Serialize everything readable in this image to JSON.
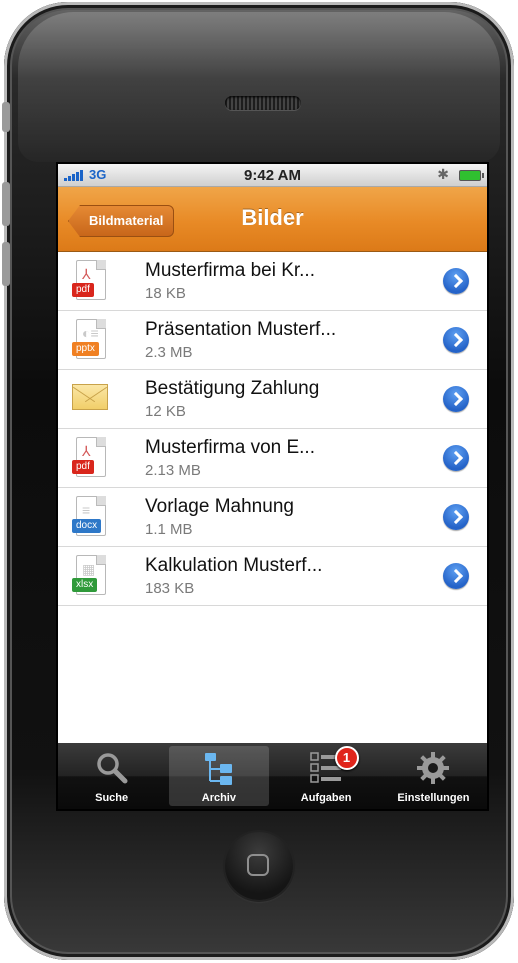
{
  "status_bar": {
    "network": "3G",
    "time": "9:42 AM"
  },
  "nav": {
    "back_label": "Bildmaterial",
    "title": "Bilder"
  },
  "files": [
    {
      "name": "Musterfirma bei Kr...",
      "size": "18 KB",
      "type": "pdf",
      "color": "#d9261c"
    },
    {
      "name": "Präsentation Musterf...",
      "size": "2.3 MB",
      "type": "pptx",
      "color": "#f08022"
    },
    {
      "name": "Bestätigung Zahlung",
      "size": "12 KB",
      "type": "mail",
      "color": "#f1cf69"
    },
    {
      "name": "Musterfirma von E...",
      "size": "2.13 MB",
      "type": "pdf",
      "color": "#d9261c"
    },
    {
      "name": "Vorlage Mahnung",
      "size": "1.1 MB",
      "type": "docx",
      "color": "#2e78c8"
    },
    {
      "name": "Kalkulation Musterf...",
      "size": "183 KB",
      "type": "xlsx",
      "color": "#2f9a3a"
    }
  ],
  "tabs": [
    {
      "label": "Suche",
      "icon": "magnifier-icon",
      "active": false
    },
    {
      "label": "Archiv",
      "icon": "folder-tree-icon",
      "active": true
    },
    {
      "label": "Aufgaben",
      "icon": "checklist-icon",
      "active": false,
      "badge": "1"
    },
    {
      "label": "Einstellungen",
      "icon": "gear-icon",
      "active": false
    }
  ],
  "colors": {
    "accent": "#e88a26",
    "link": "#2563c8"
  }
}
